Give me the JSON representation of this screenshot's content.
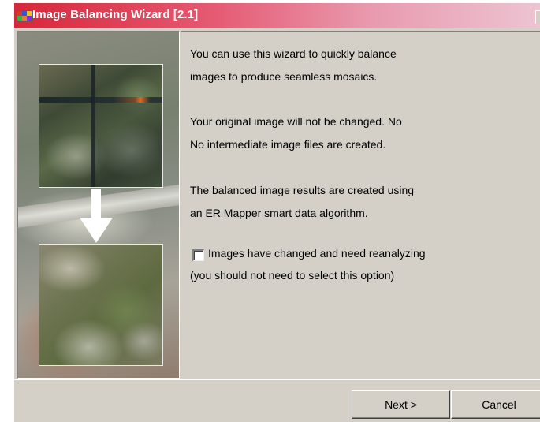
{
  "window": {
    "title": "Image Balancing Wizard [2.1]"
  },
  "content": {
    "intro_lines": [
      "You can use this wizard to quickly balance",
      "images to produce seamless mosaics."
    ],
    "original_lines": [
      "Your original image will not be changed. No",
      "No intermediate image files are created."
    ],
    "algorithm_lines": [
      "The balanced image results are created using",
      "an ER Mapper smart data algorithm."
    ],
    "reanalyze_checkbox": {
      "label": "Images have changed and need reanalyzing",
      "checked": false
    },
    "reanalyze_note": "(you should not need to select this option)"
  },
  "buttons": {
    "next_label": "Next >",
    "cancel_label": "Cancel"
  },
  "colors": {
    "title_gradient_start": "#d8263a",
    "title_gradient_end": "#ecc4d2",
    "dialog_face": "#d4d0c8"
  },
  "icons": {
    "app_icon": "image-balancing-app-icon",
    "arrow": "arrow-down-icon"
  }
}
